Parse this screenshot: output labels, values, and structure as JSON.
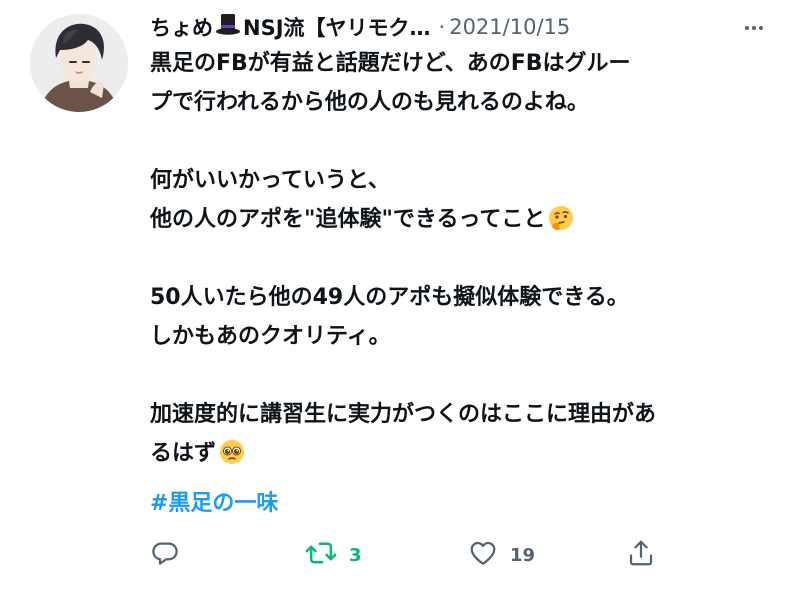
{
  "tweet": {
    "author": "ちょめ",
    "author_suffix": "NSJ流【ヤリモク…",
    "separator": "·",
    "date": "2021/10/15",
    "lines": [
      "黒足のFBが有益と話題だけど、あのFBはグルー",
      "プで行われるから他の人のも見れるのよね。",
      "",
      "何がいいかっていうと、",
      "他の人のアポを\"追体験\"できるってこと",
      "",
      "50人いたら他の49人のアポも擬似体験できる。",
      "しかもあのクオリティ。",
      "",
      "加速度的に講習生に実力がつくのはここに理由があ",
      "るはず"
    ],
    "hashtag": "#黒足の一味",
    "retweet_count": "3",
    "like_count": "19"
  },
  "colors": {
    "text": "#0f1419",
    "muted": "#536471",
    "link": "#1d9bf0",
    "retweet": "#00ba7c"
  },
  "icons": [
    "top-hat-icon",
    "more-icon",
    "thinking-face-icon",
    "pleading-face-icon",
    "reply-icon",
    "retweet-icon",
    "like-icon",
    "share-icon"
  ]
}
